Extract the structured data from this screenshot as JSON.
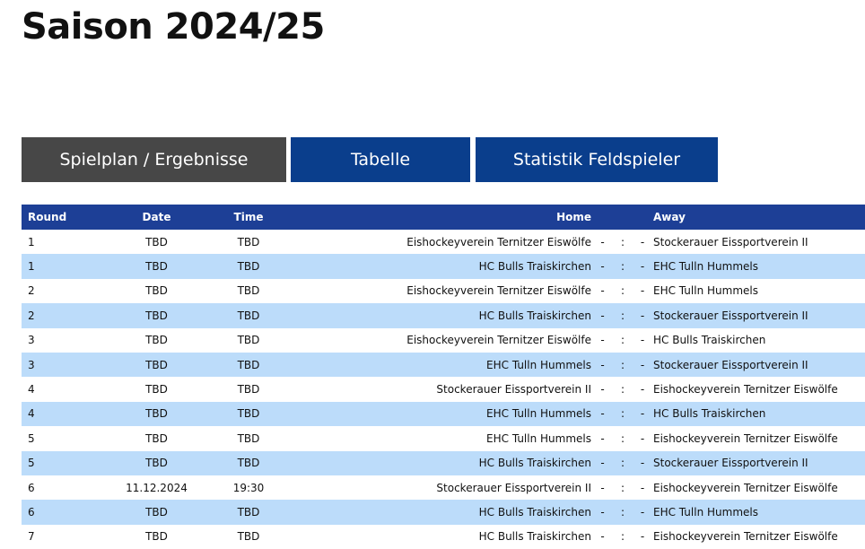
{
  "page_title": "Saison 2024/25",
  "tabs": [
    {
      "label": "Spielplan / Ergebnisse",
      "active": true
    },
    {
      "label": "Tabelle",
      "active": false
    },
    {
      "label": "Statistik Feldspieler",
      "active": false
    }
  ],
  "colors": {
    "active_tab": "#474747",
    "inactive_tab": "#0a3e8c",
    "table_header": "#1d3f96",
    "row_alt": "#bcdcfa"
  },
  "table": {
    "columns": {
      "round": "Round",
      "date": "Date",
      "time": "Time",
      "home": "Home",
      "away": "Away"
    },
    "rows": [
      {
        "round": "1",
        "date": "TBD",
        "time": "TBD",
        "home": "Eishockeyverein Ternitzer Eiswölfe",
        "score_home": "-",
        "score_sep": ":",
        "score_away": "-",
        "away": "Stockerauer Eissportverein II"
      },
      {
        "round": "1",
        "date": "TBD",
        "time": "TBD",
        "home": "HC Bulls Traiskirchen",
        "score_home": "-",
        "score_sep": ":",
        "score_away": "-",
        "away": "EHC Tulln Hummels"
      },
      {
        "round": "2",
        "date": "TBD",
        "time": "TBD",
        "home": "Eishockeyverein Ternitzer Eiswölfe",
        "score_home": "-",
        "score_sep": ":",
        "score_away": "-",
        "away": "EHC Tulln Hummels"
      },
      {
        "round": "2",
        "date": "TBD",
        "time": "TBD",
        "home": "HC Bulls Traiskirchen",
        "score_home": "-",
        "score_sep": ":",
        "score_away": "-",
        "away": "Stockerauer Eissportverein II"
      },
      {
        "round": "3",
        "date": "TBD",
        "time": "TBD",
        "home": "Eishockeyverein Ternitzer Eiswölfe",
        "score_home": "-",
        "score_sep": ":",
        "score_away": "-",
        "away": "HC Bulls Traiskirchen"
      },
      {
        "round": "3",
        "date": "TBD",
        "time": "TBD",
        "home": "EHC Tulln Hummels",
        "score_home": "-",
        "score_sep": ":",
        "score_away": "-",
        "away": "Stockerauer Eissportverein II"
      },
      {
        "round": "4",
        "date": "TBD",
        "time": "TBD",
        "home": "Stockerauer Eissportverein II",
        "score_home": "-",
        "score_sep": ":",
        "score_away": "-",
        "away": "Eishockeyverein Ternitzer Eiswölfe"
      },
      {
        "round": "4",
        "date": "TBD",
        "time": "TBD",
        "home": "EHC Tulln Hummels",
        "score_home": "-",
        "score_sep": ":",
        "score_away": "-",
        "away": "HC Bulls Traiskirchen"
      },
      {
        "round": "5",
        "date": "TBD",
        "time": "TBD",
        "home": "EHC Tulln Hummels",
        "score_home": "-",
        "score_sep": ":",
        "score_away": "-",
        "away": "Eishockeyverein Ternitzer Eiswölfe"
      },
      {
        "round": "5",
        "date": "TBD",
        "time": "TBD",
        "home": "HC Bulls Traiskirchen",
        "score_home": "-",
        "score_sep": ":",
        "score_away": "-",
        "away": "Stockerauer Eissportverein II"
      },
      {
        "round": "6",
        "date": "11.12.2024",
        "time": "19:30",
        "home": "Stockerauer Eissportverein II",
        "score_home": "-",
        "score_sep": ":",
        "score_away": "-",
        "away": "Eishockeyverein Ternitzer Eiswölfe"
      },
      {
        "round": "6",
        "date": "TBD",
        "time": "TBD",
        "home": "HC Bulls Traiskirchen",
        "score_home": "-",
        "score_sep": ":",
        "score_away": "-",
        "away": "EHC Tulln Hummels"
      },
      {
        "round": "7",
        "date": "TBD",
        "time": "TBD",
        "home": "HC Bulls Traiskirchen",
        "score_home": "-",
        "score_sep": ":",
        "score_away": "-",
        "away": "Eishockeyverein Ternitzer Eiswölfe"
      }
    ]
  }
}
